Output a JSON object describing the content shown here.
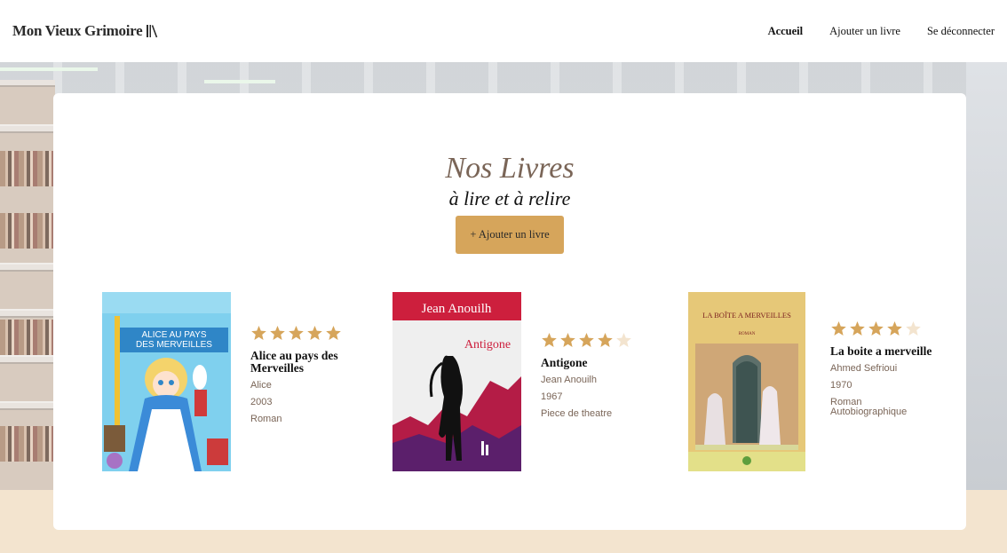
{
  "header": {
    "logo_text": "Mon Vieux Grimoire",
    "nav": [
      {
        "label": "Accueil",
        "active": true
      },
      {
        "label": "Ajouter un livre",
        "active": false
      },
      {
        "label": "Se déconnecter",
        "active": false
      }
    ]
  },
  "main": {
    "title": "Nos Livres",
    "subtitle": "à lire et à relire",
    "add_button_label": "+ Ajouter un livre"
  },
  "colors": {
    "accent": "#d6a55b",
    "star_filled": "#d6a55b",
    "star_empty": "#f3e4cf",
    "title_brown": "#7a6557"
  },
  "books": [
    {
      "title": "Alice au pays des Merveilles",
      "author": "Alice",
      "year": "2003",
      "genre": "Roman",
      "rating": 5,
      "cover": {
        "banner": "ALICE AU PAYS DES MERVEILLES"
      }
    },
    {
      "title": "Antigone",
      "author": "Jean Anouilh",
      "year": "1967",
      "genre": "Piece de theatre",
      "rating": 4,
      "cover": {
        "author": "Jean Anouilh",
        "title": "Antigone"
      }
    },
    {
      "title": "La boite a merveille",
      "author": "Ahmed Sefrioui",
      "year": "1970",
      "genre": "Roman Autobiographique",
      "rating": 4,
      "cover": {
        "title": "LA BOÎTE A MERVEILLES",
        "subtitle": "ROMAN"
      }
    }
  ]
}
